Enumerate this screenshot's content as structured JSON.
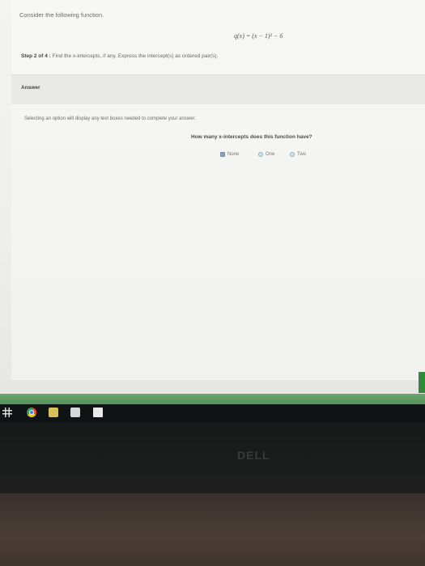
{
  "problem": {
    "intro": "Consider the following function.",
    "function": "q(x) = (x − 1)² − 6",
    "step_label": "Step 2 of 4 :",
    "step_text": "Find the x-intercepts, if any. Express the intercept(s) as ordered pair(s)."
  },
  "answer": {
    "label": "Answer",
    "hint": "Selecting an option will display any text boxes needed to complete your answer.",
    "question": "How many x-intercepts does this function have?",
    "options": [
      "None",
      "One",
      "Two"
    ],
    "selected": "None"
  },
  "monitor": {
    "brand": "DELL"
  },
  "colors": {
    "taskbar_green": "#4c8b52",
    "radio_fill": "#cfe7ea",
    "selected_fill": "#8fa0b8"
  },
  "icons": [
    "windows-icon",
    "chrome-icon",
    "file-explorer-icon",
    "store-icon",
    "mail-icon"
  ]
}
